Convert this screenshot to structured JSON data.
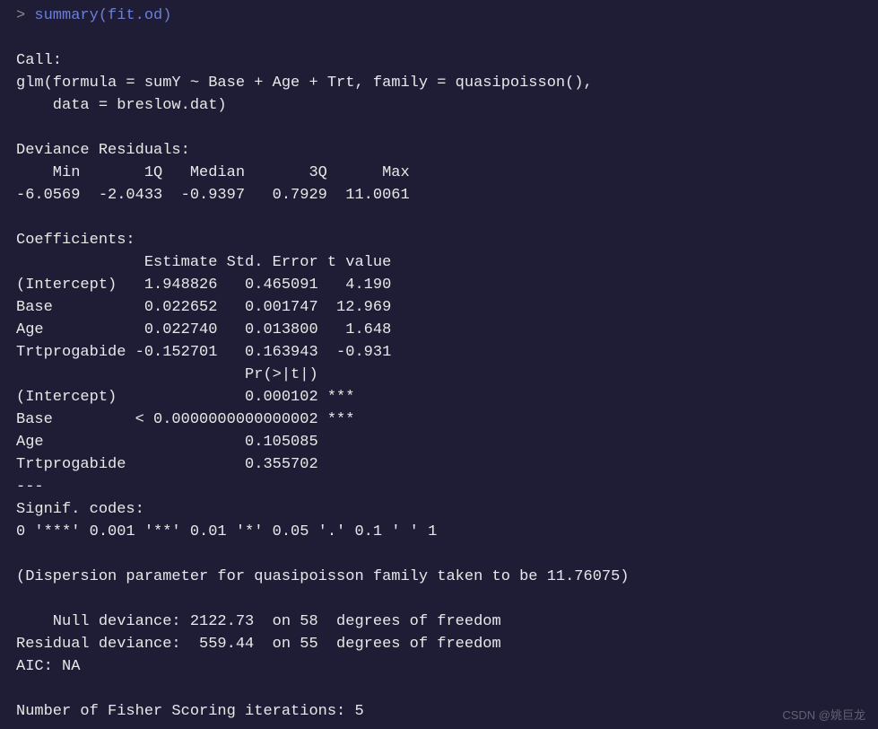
{
  "console": {
    "prompt": ">",
    "command": "summary(fit.od)"
  },
  "output": {
    "call_header": "Call:",
    "call_line1": "glm(formula = sumY ~ Base + Age + Trt, family = quasipoisson(), ",
    "call_line2": "    data = breslow.dat)",
    "dev_resid_header": "Deviance Residuals: ",
    "dev_resid_cols": "    Min       1Q   Median       3Q      Max  ",
    "dev_resid_vals": "-6.0569  -2.0433  -0.9397   0.7929  11.0061  ",
    "coef_header": "Coefficients:",
    "coef_cols": "              Estimate Std. Error t value",
    "coef_intercept": "(Intercept)   1.948826   0.465091   4.190",
    "coef_base": "Base          0.022652   0.001747  12.969",
    "coef_age": "Age           0.022740   0.013800   1.648",
    "coef_trt": "Trtprogabide -0.152701   0.163943  -0.931",
    "coef_pval_header": "                         Pr(>|t|)    ",
    "coef_pval_intercept": "(Intercept)              0.000102 ***",
    "coef_pval_base": "Base         < 0.0000000000000002 ***",
    "coef_pval_age": "Age                      0.105085    ",
    "coef_pval_trt": "Trtprogabide             0.355702    ",
    "separator": "---",
    "signif_header": "Signif. codes:  ",
    "signif_codes": "0 '***' 0.001 '**' 0.01 '*' 0.05 '.' 0.1 ' ' 1",
    "dispersion": "(Dispersion parameter for quasipoisson family taken to be 11.76075)",
    "null_deviance": "    Null deviance: 2122.73  on 58  degrees of freedom",
    "resid_deviance": "Residual deviance:  559.44  on 55  degrees of freedom",
    "aic": "AIC: NA",
    "fisher_iterations": "Number of Fisher Scoring iterations: 5"
  },
  "watermark": "CSDN @姚巨龙"
}
